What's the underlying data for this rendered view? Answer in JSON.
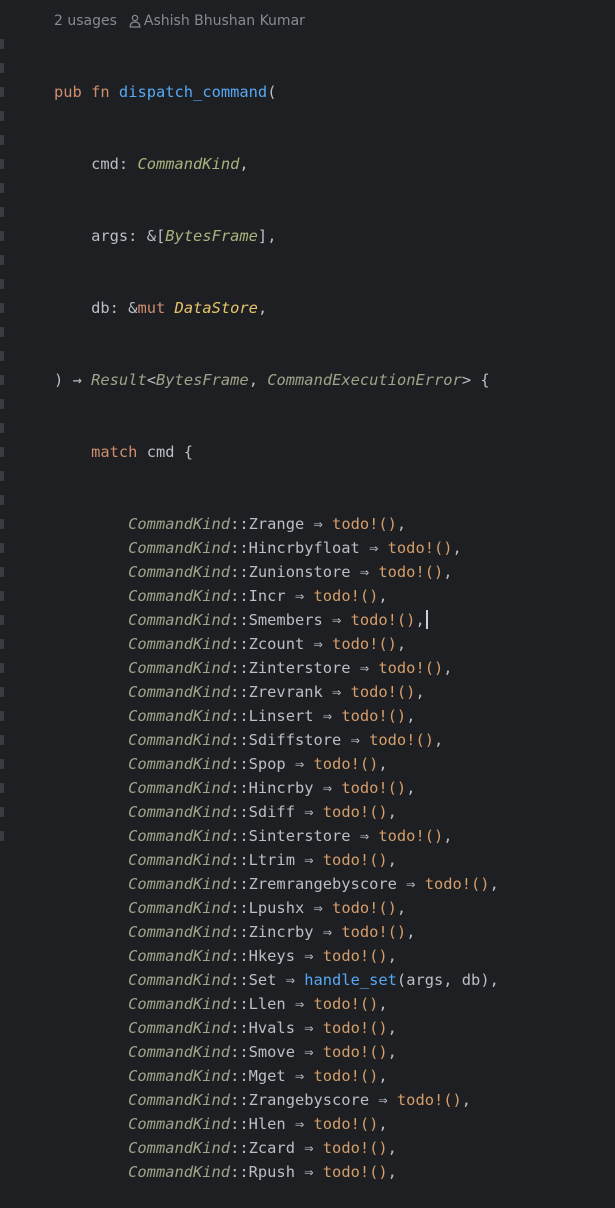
{
  "inlay": {
    "usages": "2 usages",
    "author": "Ashish Bhushan Kumar"
  },
  "colors": {
    "background": "#1e1f22",
    "keyword": "#cf8e6d",
    "function": "#56a8f5",
    "enum": "#9ea38a",
    "macro": "#d59e6b"
  },
  "signature": {
    "kw_pub": "pub",
    "kw_fn": "fn",
    "name": "dispatch_command",
    "open": "(",
    "p1_name": "cmd",
    "p1_type": "CommandKind",
    "p2_name": "args",
    "p2_prefix": "&[",
    "p2_type": "BytesFrame",
    "p2_suffix": "],",
    "p3_name": "db",
    "p3_prefix": "&",
    "p3_mut": "mut",
    "p3_type": "DataStore",
    "close": ")",
    "arrow": "→",
    "ret_type": "Result",
    "ret_lt": "<",
    "ret_t1": "BytesFrame",
    "ret_comma": ", ",
    "ret_t2": "CommandExecutionError",
    "ret_gt": ">",
    "brace": "{"
  },
  "match": {
    "kw": "match",
    "subject": "cmd",
    "brace": "{"
  },
  "arms": [
    {
      "enum": "CommandKind",
      "variant": "Zrange",
      "body": "todo!()",
      "kind": "macro"
    },
    {
      "enum": "CommandKind",
      "variant": "Hincrbyfloat",
      "body": "todo!()",
      "kind": "macro"
    },
    {
      "enum": "CommandKind",
      "variant": "Zunionstore",
      "body": "todo!()",
      "kind": "macro"
    },
    {
      "enum": "CommandKind",
      "variant": "Incr",
      "body": "todo!()",
      "kind": "macro"
    },
    {
      "enum": "CommandKind",
      "variant": "Smembers",
      "body": "todo!()",
      "kind": "macro"
    },
    {
      "enum": "CommandKind",
      "variant": "Zcount",
      "body": "todo!()",
      "kind": "macro"
    },
    {
      "enum": "CommandKind",
      "variant": "Zinterstore",
      "body": "todo!()",
      "kind": "macro"
    },
    {
      "enum": "CommandKind",
      "variant": "Zrevrank",
      "body": "todo!()",
      "kind": "macro"
    },
    {
      "enum": "CommandKind",
      "variant": "Linsert",
      "body": "todo!()",
      "kind": "macro"
    },
    {
      "enum": "CommandKind",
      "variant": "Sdiffstore",
      "body": "todo!()",
      "kind": "macro"
    },
    {
      "enum": "CommandKind",
      "variant": "Spop",
      "body": "todo!()",
      "kind": "macro"
    },
    {
      "enum": "CommandKind",
      "variant": "Hincrby",
      "body": "todo!()",
      "kind": "macro"
    },
    {
      "enum": "CommandKind",
      "variant": "Sdiff",
      "body": "todo!()",
      "kind": "macro"
    },
    {
      "enum": "CommandKind",
      "variant": "Sinterstore",
      "body": "todo!()",
      "kind": "macro"
    },
    {
      "enum": "CommandKind",
      "variant": "Ltrim",
      "body": "todo!()",
      "kind": "macro"
    },
    {
      "enum": "CommandKind",
      "variant": "Zremrangebyscore",
      "body": "todo!()",
      "kind": "macro"
    },
    {
      "enum": "CommandKind",
      "variant": "Lpushx",
      "body": "todo!()",
      "kind": "macro"
    },
    {
      "enum": "CommandKind",
      "variant": "Zincrby",
      "body": "todo!()",
      "kind": "macro"
    },
    {
      "enum": "CommandKind",
      "variant": "Hkeys",
      "body": "todo!()",
      "kind": "macro"
    },
    {
      "enum": "CommandKind",
      "variant": "Set",
      "body": "handle_set",
      "args": "(args, db)",
      "kind": "call"
    },
    {
      "enum": "CommandKind",
      "variant": "Llen",
      "body": "todo!()",
      "kind": "macro"
    },
    {
      "enum": "CommandKind",
      "variant": "Hvals",
      "body": "todo!()",
      "kind": "macro"
    },
    {
      "enum": "CommandKind",
      "variant": "Smove",
      "body": "todo!()",
      "kind": "macro"
    },
    {
      "enum": "CommandKind",
      "variant": "Mget",
      "body": "todo!()",
      "kind": "macro"
    },
    {
      "enum": "CommandKind",
      "variant": "Zrangebyscore",
      "body": "todo!()",
      "kind": "macro"
    },
    {
      "enum": "CommandKind",
      "variant": "Hlen",
      "body": "todo!()",
      "kind": "macro"
    },
    {
      "enum": "CommandKind",
      "variant": "Zcard",
      "body": "todo!()",
      "kind": "macro"
    },
    {
      "enum": "CommandKind",
      "variant": "Rpush",
      "body": "todo!()",
      "kind": "macro"
    }
  ],
  "tokens": {
    "path_sep": "::",
    "fat_arrow": "⇒",
    "comma": ","
  },
  "cursor": {
    "arm_index": 4
  }
}
